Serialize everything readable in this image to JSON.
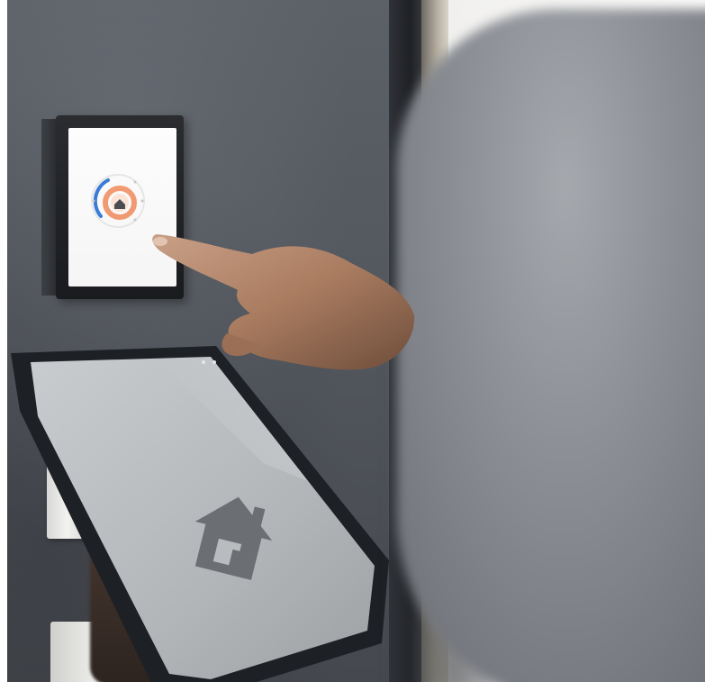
{
  "scene": {
    "colors": {
      "wall": "#54585f",
      "panel_frame": "#1f2024",
      "panel_screen": "#f8f8f8",
      "dial_blue": "#3a7bd5",
      "dial_orange": "#f08a5a",
      "tablet_bezel": "#22252a",
      "tablet_screen": "#b9bcbf",
      "house_icon": "#6b6e72",
      "skin": "#b98a6c",
      "background_right": "#f7f6f4",
      "person": "#8a8d92"
    },
    "icons": [
      "thermostat-dial-icon",
      "home-icon",
      "house-icon"
    ]
  }
}
